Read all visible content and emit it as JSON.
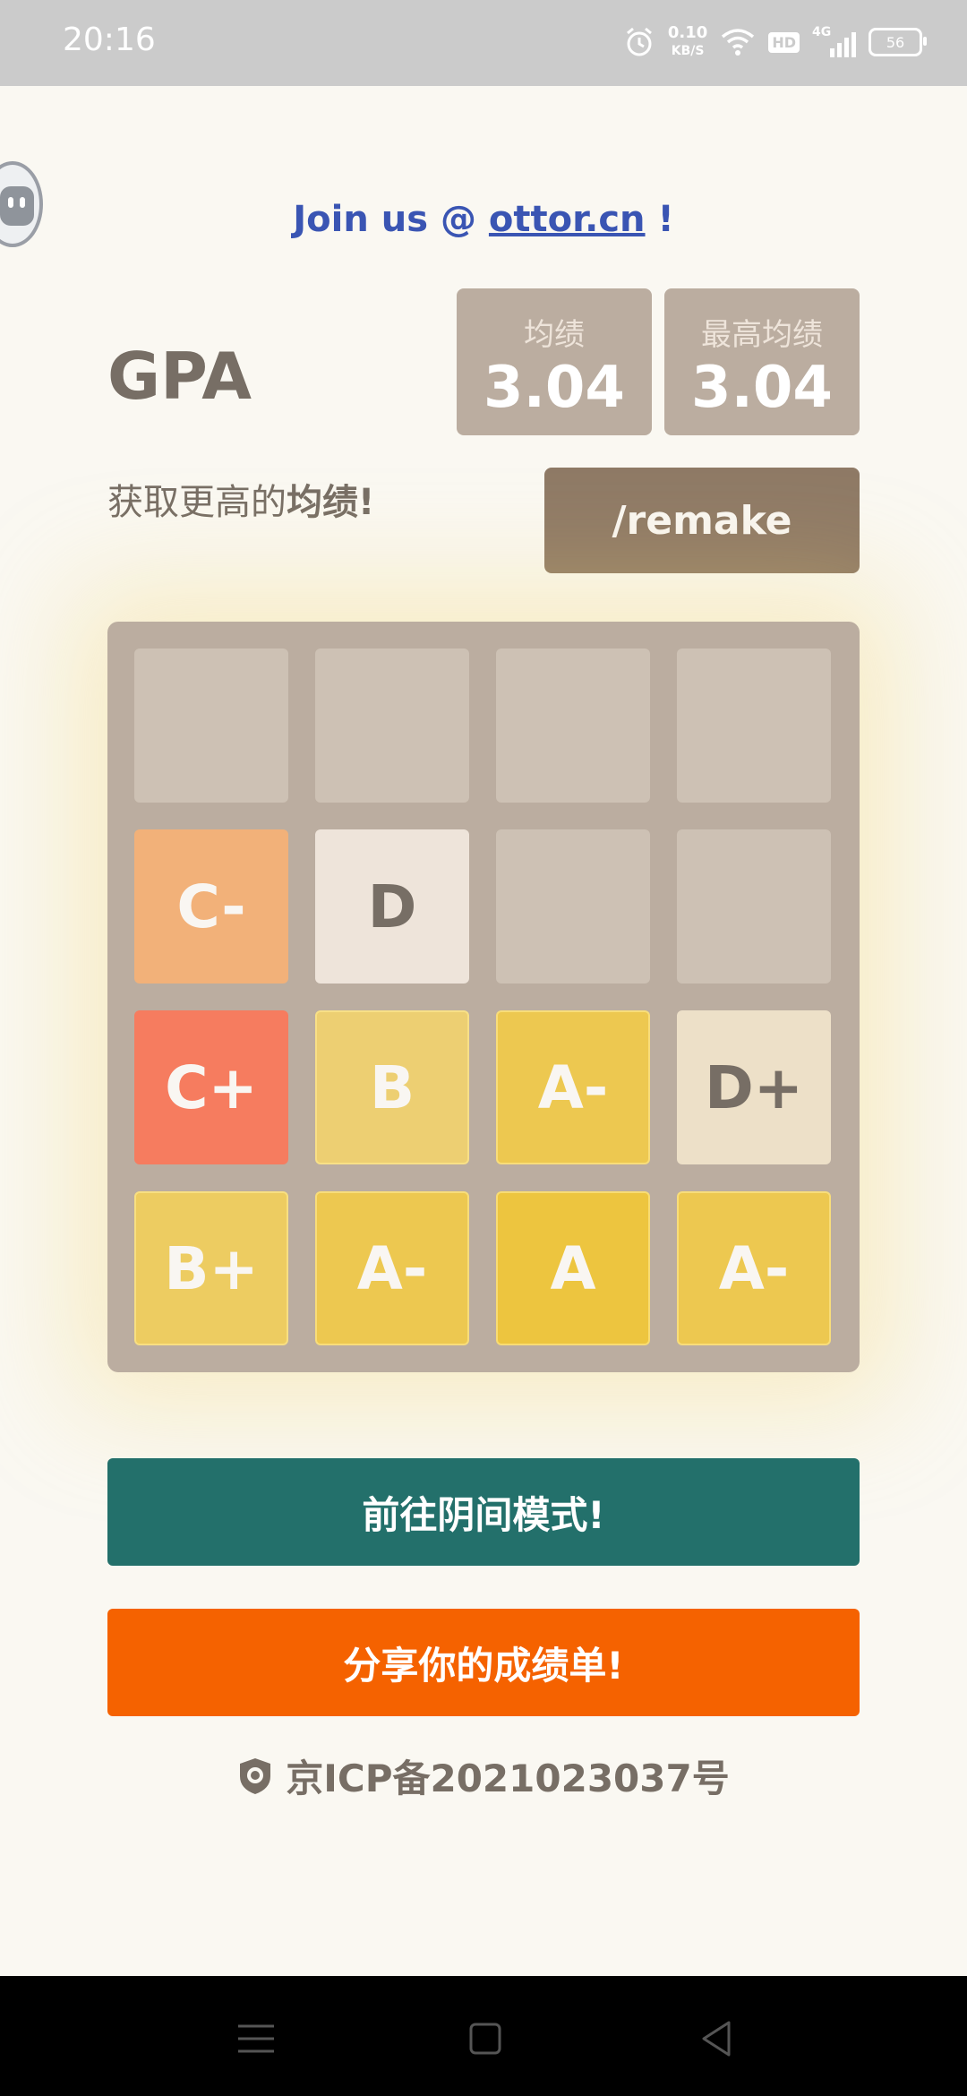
{
  "status_bar": {
    "time": "20:16",
    "net_speed_value": "0.10",
    "net_speed_unit": "KB/S",
    "hd_label": "HD",
    "network_label": "4G",
    "battery_level": "56",
    "icons": [
      "alarm-icon",
      "wifi-icon",
      "hd-icon",
      "signal-icon",
      "battery-icon"
    ]
  },
  "header": {
    "join_prefix": "Join us @ ",
    "join_link": "ottor.cn",
    "join_suffix": " !"
  },
  "game": {
    "title": "GPA",
    "score_label": "均绩",
    "score_value": "3.04",
    "best_label": "最高均绩",
    "best_value": "3.04",
    "subtitle_prefix": "获取更高的",
    "subtitle_bold": "均绩!",
    "remake_label": "/remake"
  },
  "board": {
    "rows": [
      [
        "",
        "",
        "",
        ""
      ],
      [
        "C-",
        "D",
        "",
        ""
      ],
      [
        "C+",
        "B",
        "A-",
        "D+"
      ],
      [
        "B+",
        "A-",
        "A",
        "A-"
      ]
    ],
    "colors": {
      "board_bg": "#bbada0",
      "empty": "#cdc1b4",
      "D": "#eee4da",
      "D+": "#ede0c8",
      "C-": "#f2b179",
      "C+": "#f67c5f",
      "B": "#edcf72",
      "B+": "#edcc61",
      "A-": "#edc850",
      "A": "#edc53f"
    }
  },
  "actions": {
    "dark_mode_label": "前往阴间模式!",
    "share_label": "分享你的成绩单!"
  },
  "footer": {
    "icp_text": "京ICP备2021023037号"
  }
}
